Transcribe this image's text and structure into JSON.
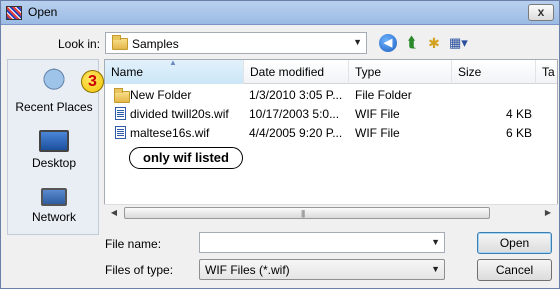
{
  "window": {
    "title": "Open",
    "close_label": "x"
  },
  "lookin": {
    "label": "Look in:",
    "value": "Samples"
  },
  "toolbar": {
    "back": "back-icon",
    "up": "up-folder-icon",
    "new_folder": "new-folder-icon",
    "views": "views-menu-icon"
  },
  "places": [
    {
      "label": "Recent Places",
      "icon": "recent-places-icon"
    },
    {
      "label": "Desktop",
      "icon": "desktop-icon"
    },
    {
      "label": "Network",
      "icon": "network-icon"
    }
  ],
  "columns": {
    "name": "Name",
    "date": "Date modified",
    "type": "Type",
    "size": "Size",
    "tags": "Ta"
  },
  "files": [
    {
      "name": "New Folder",
      "date": "1/3/2010 3:05 P...",
      "type": "File Folder",
      "size": "",
      "icon": "folder-icon"
    },
    {
      "name": "divided twill20s.wif",
      "date": "10/17/2003 5:0...",
      "type": "WIF File",
      "size": "4 KB",
      "icon": "wif-file-icon"
    },
    {
      "name": "maltese16s.wif",
      "date": "4/4/2005 9:20 P...",
      "type": "WIF File",
      "size": "6 KB",
      "icon": "wif-file-icon"
    }
  ],
  "annotation": {
    "badge": "3",
    "callout": "only wif listed"
  },
  "filename": {
    "label": "File name:",
    "value": ""
  },
  "filetype": {
    "label": "Files of type:",
    "value": "WIF Files (*.wif)"
  },
  "buttons": {
    "open": "Open",
    "cancel": "Cancel"
  },
  "colors": {
    "title_bar": "#9bbbe4",
    "selected_header": "#cbe6f7",
    "badge": "#f2c400",
    "badge_text": "#cc0000"
  }
}
